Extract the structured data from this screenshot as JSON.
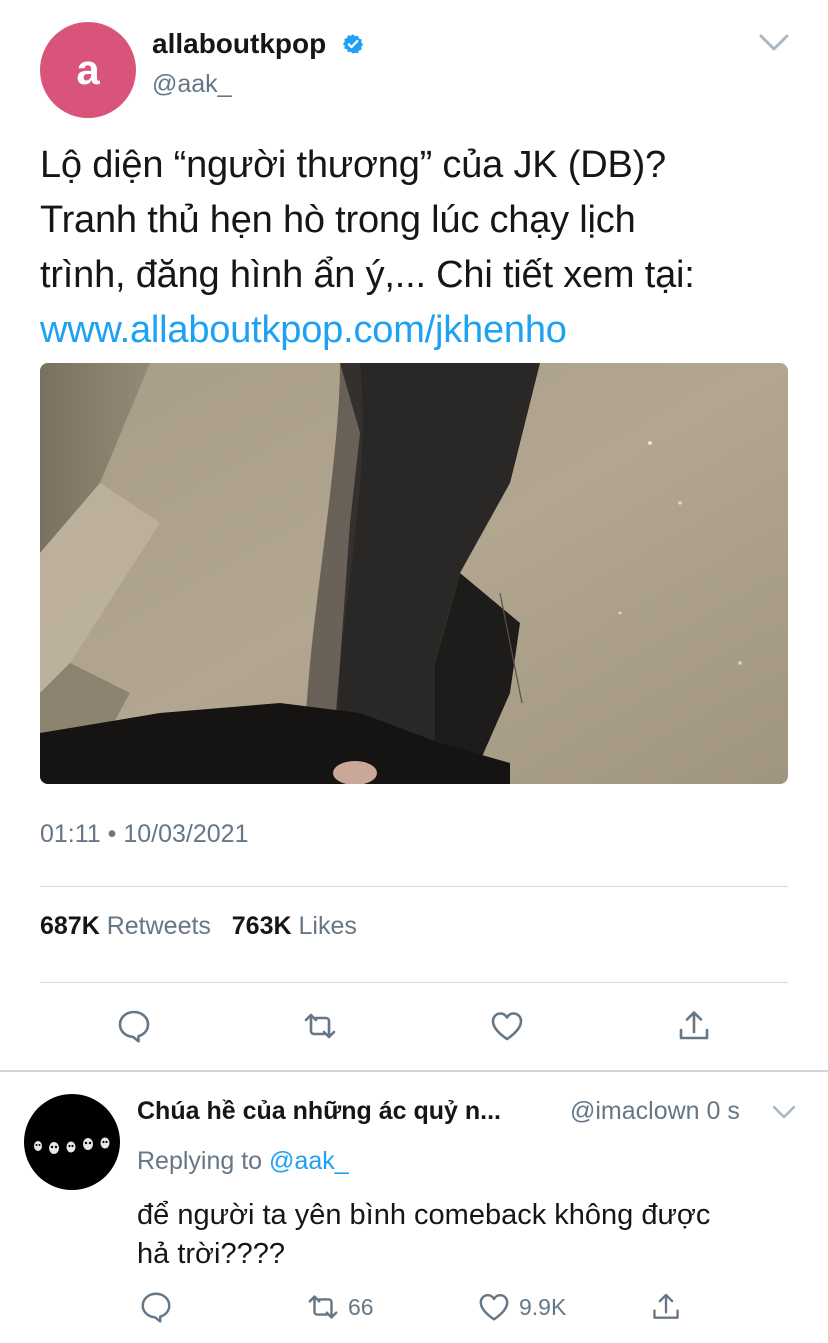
{
  "tweet": {
    "avatar_letter": "a",
    "display_name": "allaboutkpop",
    "handle": "@aak_",
    "text_line1": "Lộ diện “người thương” của JK (DB)?",
    "text_line2": "Tranh thủ hẹn hò trong lúc chạy lịch",
    "text_line3": "trình, đăng hình ẩn ý,... Chi tiết xem tại:",
    "link": "www.allaboutkpop.com/jkhenho",
    "timestamp": "01:11 • 10/03/2021",
    "retweets_count": "687K",
    "retweets_label": "Retweets",
    "likes_count": "763K",
    "likes_label": "Likes"
  },
  "reply": {
    "display_name": "Chúa hề của những ác quỷ n...",
    "handle_time": "@imaclown 0 s",
    "replying_prefix": "Replying to",
    "replying_handle": "@aak_",
    "text_line1": "để người ta yên bình comeback không được",
    "text_line2": "hả trời????",
    "retweet_count": "66",
    "like_count": "9.9K"
  },
  "icons": {
    "verified": "verified-badge-icon",
    "more": "chevron-down-icon",
    "reply": "reply-icon",
    "retweet": "retweet-icon",
    "like": "heart-icon",
    "share": "share-icon"
  },
  "colors": {
    "accent": "#1da1f2",
    "avatar_bg": "#d9547a",
    "secondary_text": "#657786"
  }
}
